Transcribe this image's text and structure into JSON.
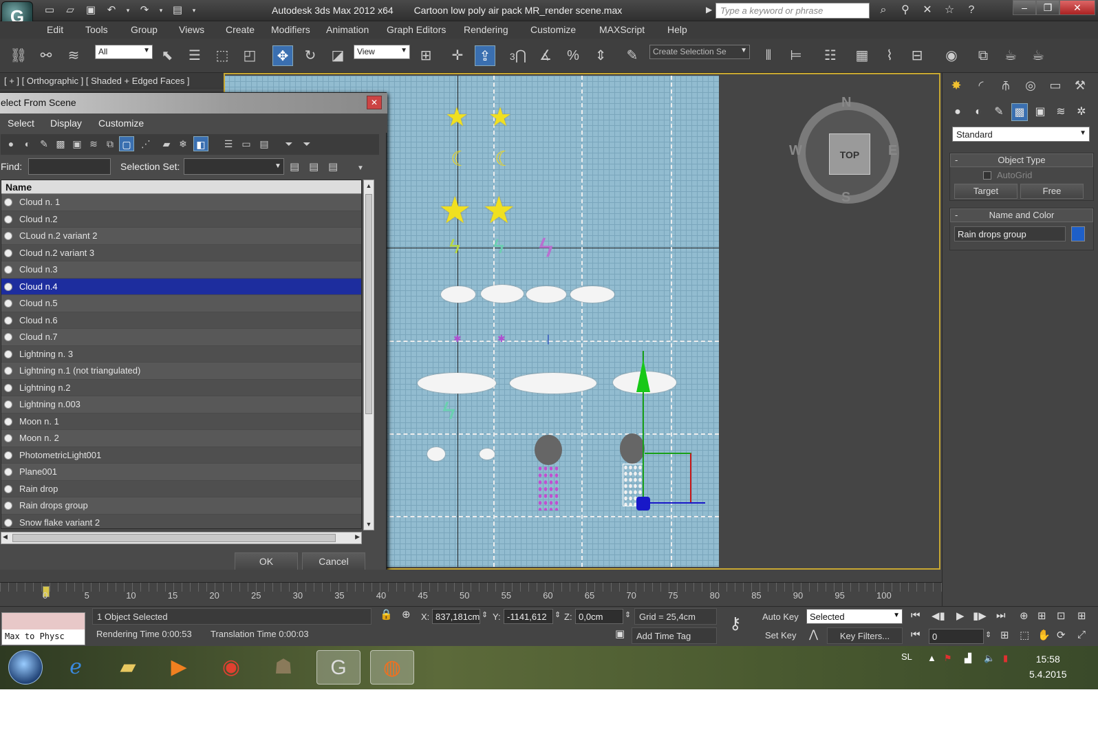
{
  "title": {
    "app": "Autodesk 3ds Max  2012 x64",
    "file": "Cartoon low poly air pack MR_render scene.max",
    "search_placeholder": "Type a keyword or phrase"
  },
  "menu": [
    "Edit",
    "Tools",
    "Group",
    "Views",
    "Create",
    "Modifiers",
    "Animation",
    "Graph Editors",
    "Rendering",
    "Customize",
    "MAXScript",
    "Help"
  ],
  "toolbar": {
    "filter": "All",
    "coord": "View",
    "selection_set_placeholder": "Create Selection Se",
    "snap_label": "3"
  },
  "viewport": {
    "label": "[ + ] [ Orthographic ] [ Shaded + Edged Faces ]",
    "viewcube": "TOP",
    "compass": {
      "n": "N",
      "s": "S",
      "e": "E",
      "w": "W"
    }
  },
  "command_panel": {
    "category": "Standard",
    "object_type": {
      "header": "Object Type",
      "autogrid": "AutoGrid",
      "buttons": [
        "Target",
        "Free"
      ]
    },
    "name_color": {
      "header": "Name and Color",
      "name": "Rain drops group",
      "color": "#1e5fc8"
    }
  },
  "dialog": {
    "title": "elect From Scene",
    "menu": [
      "Select",
      "Display",
      "Customize"
    ],
    "find_label": "Find:",
    "find_value": "",
    "selset_label": "Selection Set:",
    "column_header": "Name",
    "items": [
      "Cloud n. 1",
      "Cloud n.2",
      "CLoud n.2 variant 2",
      "Cloud n.2 variant 3",
      "Cloud n.3",
      "Cloud n.4",
      "Cloud n.5",
      "Cloud n.6",
      "Cloud n.7",
      "Lightning n. 3",
      "Lightning n.1 (not triangulated)",
      "Lightning n.2",
      "Lightning n.003",
      "Moon n. 1",
      "Moon n. 2",
      "PhotometricLight001",
      "Plane001",
      "Rain drop",
      "Rain drops group",
      "Snow flake variant 2"
    ],
    "selected_index": 5,
    "ok": "OK",
    "cancel": "Cancel"
  },
  "timeline": {
    "ticks": [
      "0",
      "5",
      "10",
      "15",
      "20",
      "25",
      "30",
      "35",
      "40",
      "45",
      "50",
      "55",
      "60",
      "65",
      "70",
      "75",
      "80",
      "85",
      "90",
      "95",
      "100"
    ]
  },
  "status": {
    "maxscript": "Max to Physc",
    "selected": "1 Object Selected",
    "render_time": "Rendering Time  0:00:53",
    "translation_time": "Translation Time  0:00:03",
    "x_label": "X:",
    "x": "837,181cm",
    "y_label": "Y:",
    "y": "-1141,612",
    "z_label": "Z:",
    "z": "0,0cm",
    "grid": "Grid = 25,4cm",
    "add_time_tag": "Add Time Tag",
    "auto_key": "Auto Key",
    "auto_key_mode": "Selected",
    "set_key": "Set Key",
    "key_filters": "Key Filters...",
    "frame": "0"
  },
  "taskbar": {
    "lang": "SL",
    "time": "15:58",
    "date": "5.4.2015"
  }
}
